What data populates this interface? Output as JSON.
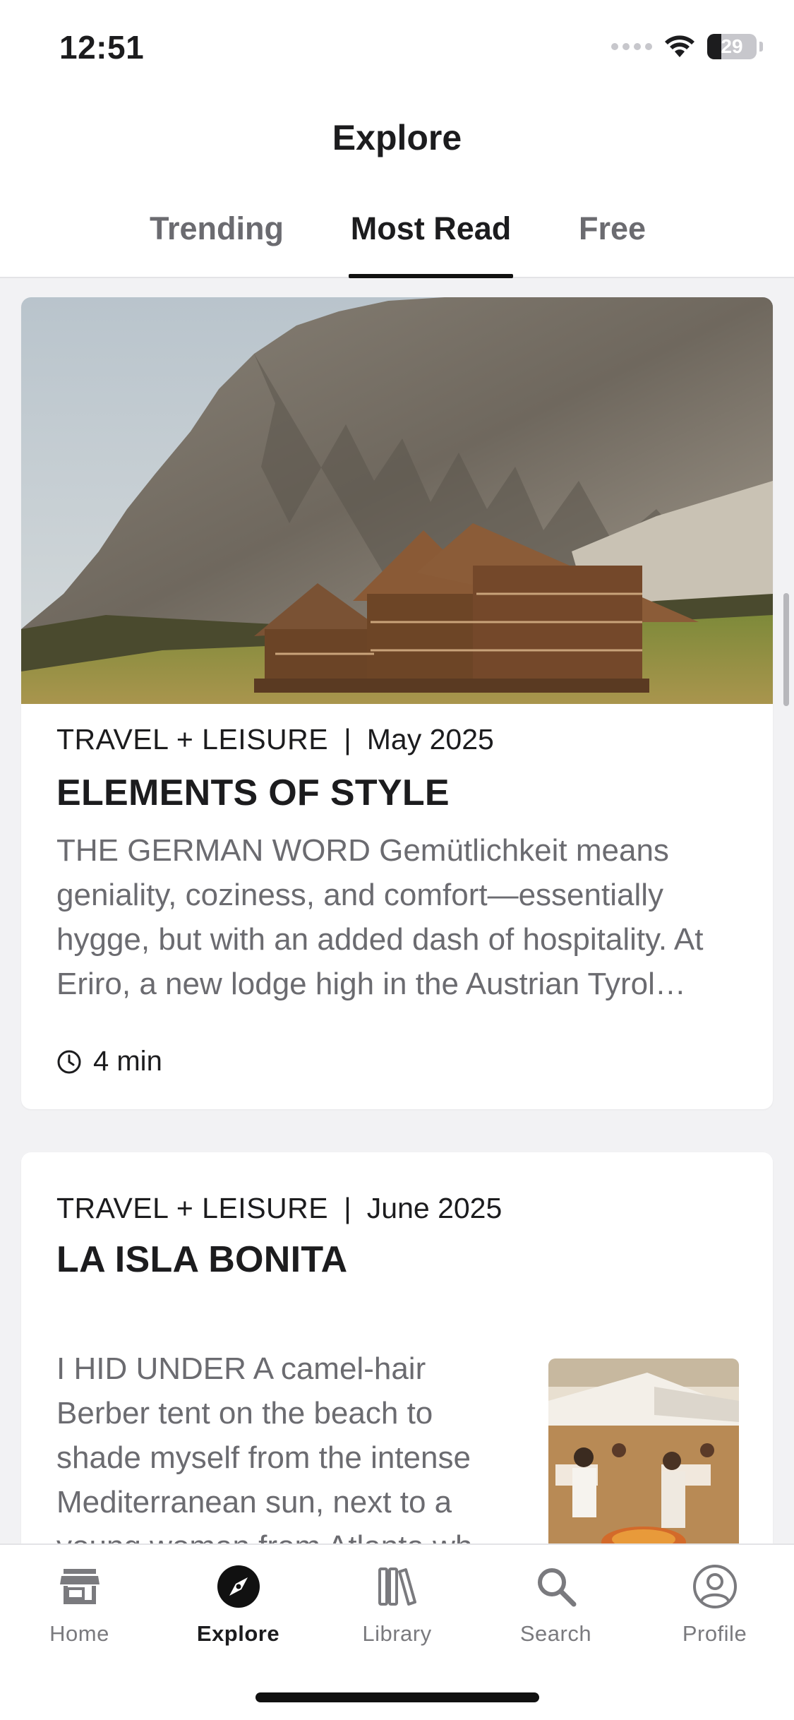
{
  "status_bar": {
    "time": "12:51",
    "battery_level": "29",
    "battery_fraction": 0.29
  },
  "header": {
    "title": "Explore"
  },
  "tabs": [
    {
      "label": "Trending",
      "active": false
    },
    {
      "label": "Most Read",
      "active": true
    },
    {
      "label": "Free",
      "active": false
    }
  ],
  "articles": [
    {
      "publication": "TRAVEL + LEISURE",
      "separator": "|",
      "date": "May 2025",
      "headline": "ELEMENTS OF STYLE",
      "excerpt": "THE GERMAN WORD Gemütlichkeit means geniality, coziness, and comfort—essentially hygge, but with an added dash of hospitality. At Eriro, a new lodge high in the Austrian Tyrol…",
      "read_time": "4 min",
      "image": "mountain-lodge-photo"
    },
    {
      "publication": "TRAVEL + LEISURE",
      "separator": "|",
      "date": "June 2025",
      "headline": "LA ISLA BONITA",
      "excerpt": "I HID UNDER A camel-hair Berber tent on the beach to shade myself from the intense Mediterranean sun, next to a young woman from Atlanta wh",
      "image": "beach-restaurant-photo"
    }
  ],
  "tab_bar": [
    {
      "label": "Home",
      "icon": "storefront-icon",
      "active": false
    },
    {
      "label": "Explore",
      "icon": "compass-icon",
      "active": true
    },
    {
      "label": "Library",
      "icon": "books-icon",
      "active": false
    },
    {
      "label": "Search",
      "icon": "magnifier-icon",
      "active": false
    },
    {
      "label": "Profile",
      "icon": "person-circle-icon",
      "active": false
    }
  ],
  "colors": {
    "accent": "#111111",
    "inactive": "#7a7a7e",
    "excerpt": "#6b6b70",
    "background": "#f2f2f4"
  }
}
